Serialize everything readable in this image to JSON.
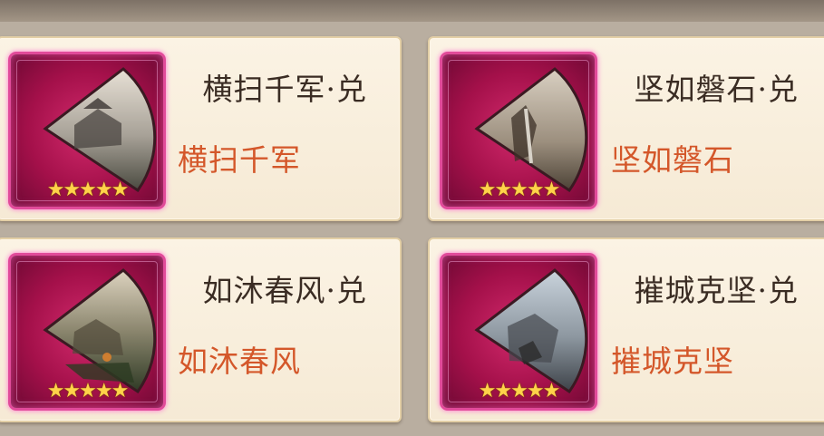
{
  "cards": [
    {
      "title": "横扫千军·兑",
      "subtitle": "横扫千军",
      "stars": "★★★★★",
      "rating": 5,
      "icon": "fan-palace-icon"
    },
    {
      "title": "坚如磐石·兑",
      "subtitle": "坚如磐石",
      "stars": "★★★★★",
      "rating": 5,
      "icon": "fan-warrior-icon"
    },
    {
      "title": "如沐春风·兑",
      "subtitle": "如沐春风",
      "stars": "★★★★★",
      "rating": 5,
      "icon": "fan-landscape-icon"
    },
    {
      "title": "摧城克坚·兑",
      "subtitle": "摧城克坚",
      "stars": "★★★★★",
      "rating": 5,
      "icon": "fan-siege-icon"
    }
  ],
  "colors": {
    "title": "#3a2c23",
    "subtitle": "#d4572a",
    "frame": "#a4104a",
    "star": "#ffd24a"
  }
}
